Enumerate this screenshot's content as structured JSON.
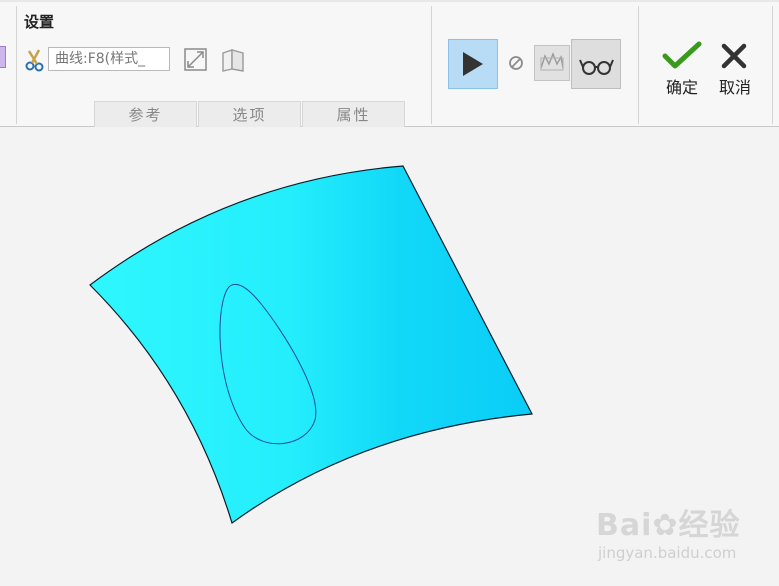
{
  "ribbon": {
    "group_title": "设置",
    "curve_field_value": "曲线:F8(样式_",
    "tabs": [
      "参考",
      "选项",
      "属性"
    ],
    "ok_label": "确定",
    "cancel_label": "取消"
  },
  "icons": {
    "trim": "scissors-icon",
    "flip": "flip-direction-icon",
    "book": "open-book-icon",
    "play": "play-icon",
    "pause": "pause-icon",
    "verify": "verify-mode-icon",
    "preview": "glasses-icon",
    "ok": "checkmark-icon",
    "cancel": "x-icon"
  },
  "colors": {
    "surface_light": "#2ff7ff",
    "surface_dark": "#0acdf7",
    "play_highlight": "#b8dcf5",
    "check_green": "#3a9a1c"
  },
  "watermark": {
    "brand": "Bai",
    "brand_cn": "经验",
    "url": "jingyan.baidu.com"
  }
}
